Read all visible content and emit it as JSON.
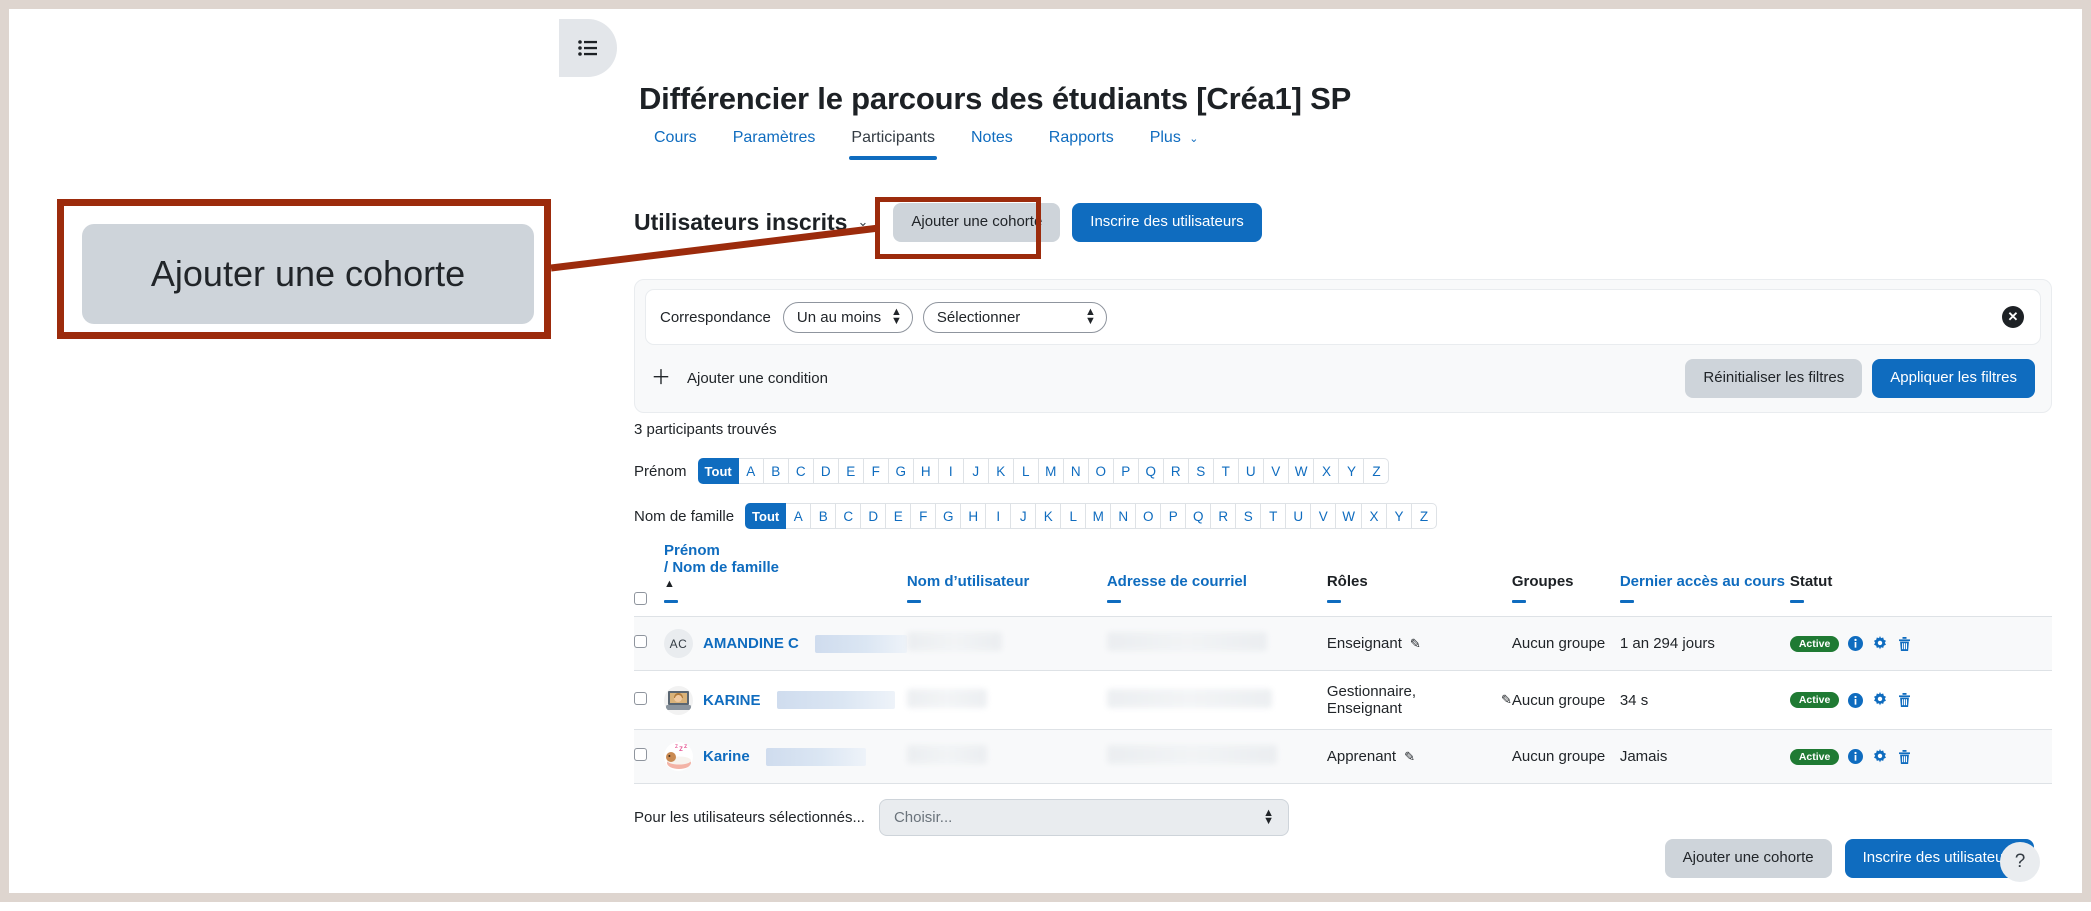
{
  "window": {
    "frame_color": "#ded5cf"
  },
  "drawer": {
    "toggle_icon": "list-icon"
  },
  "header": {
    "course_title": "Différencier le parcours des étudiants [Créa1] SP",
    "tabs": [
      {
        "label": "Cours",
        "active": false
      },
      {
        "label": "Paramètres",
        "active": false
      },
      {
        "label": "Participants",
        "active": true
      },
      {
        "label": "Notes",
        "active": false
      },
      {
        "label": "Rapports",
        "active": false
      },
      {
        "label": "Plus",
        "active": false,
        "caret": "⌄"
      }
    ]
  },
  "toolbar": {
    "enrolled_heading": "Utilisateurs inscrits",
    "heading_caret": "⌄",
    "add_cohort_label": "Ajouter une cohorte",
    "enrol_users_label": "Inscrire des utilisateurs"
  },
  "filters": {
    "match_label": "Correspondance",
    "match_value": "Un au moins",
    "field_value": "Sélectionner",
    "clear_icon": "close-icon",
    "add_condition_label": "Ajouter une condition",
    "add_condition_icon": "plus-icon",
    "reset_label": "Réinitialiser les filtres",
    "apply_label": "Appliquer les filtres"
  },
  "results": {
    "count_text": "3 participants trouvés"
  },
  "alpha": {
    "firstname_label": "Prénom",
    "lastname_label": "Nom de famille",
    "all_label": "Tout",
    "letters": [
      "A",
      "B",
      "C",
      "D",
      "E",
      "F",
      "G",
      "H",
      "I",
      "J",
      "K",
      "L",
      "M",
      "N",
      "O",
      "P",
      "Q",
      "R",
      "S",
      "T",
      "U",
      "V",
      "W",
      "X",
      "Y",
      "Z"
    ]
  },
  "table": {
    "headers": {
      "name_line1": "Prénom",
      "name_line2": "/ Nom de famille",
      "sort_caret": "▲",
      "username": "Nom d’utilisateur",
      "email": "Adresse de courriel",
      "roles": "Rôles",
      "groups": "Groupes",
      "last_access": "Dernier accès au cours",
      "status": "Statut"
    },
    "rows": [
      {
        "avatar_type": "initials",
        "avatar_initials": "AC",
        "name": "AMANDINE",
        "name_suffix": "C",
        "username_redacted": true,
        "email_redacted": true,
        "roles": "Enseignant",
        "role_edit_icon": "pencil-icon",
        "groups": "Aucun groupe",
        "last_access": "1 an 294 jours",
        "status": "Active",
        "status_icons": [
          "info-icon",
          "gear-icon",
          "trash-icon"
        ]
      },
      {
        "avatar_type": "photo",
        "avatar_initials": "",
        "name": "KARINE",
        "name_suffix": "",
        "username_redacted": true,
        "email_redacted": true,
        "roles": "Gestionnaire, Enseignant",
        "role_edit_icon": "pencil-icon",
        "groups": "Aucun groupe",
        "last_access": "34 s",
        "status": "Active",
        "status_icons": [
          "info-icon",
          "gear-icon",
          "trash-icon"
        ]
      },
      {
        "avatar_type": "photo",
        "avatar_initials": "",
        "name": "Karine",
        "name_suffix": "",
        "username_redacted": true,
        "email_redacted": true,
        "roles": "Apprenant",
        "role_edit_icon": "pencil-icon",
        "groups": "Aucun groupe",
        "last_access": "Jamais",
        "status": "Active",
        "status_icons": [
          "info-icon",
          "gear-icon",
          "trash-icon"
        ]
      }
    ]
  },
  "bulk": {
    "label": "Pour les utilisateurs sélectionnés...",
    "placeholder": "Choisir..."
  },
  "footer": {
    "add_cohort_label": "Ajouter une cohorte",
    "enrol_users_label": "Inscrire des utilisateurs",
    "help_label": "?"
  },
  "annotation": {
    "callout_text": "Ajouter une cohorte",
    "highlight_color": "#9c2b0c"
  },
  "colors": {
    "primary": "#0f6cbf",
    "secondary": "#ced4da",
    "active_badge": "#1f7a33",
    "annotation": "#9c2b0c"
  }
}
